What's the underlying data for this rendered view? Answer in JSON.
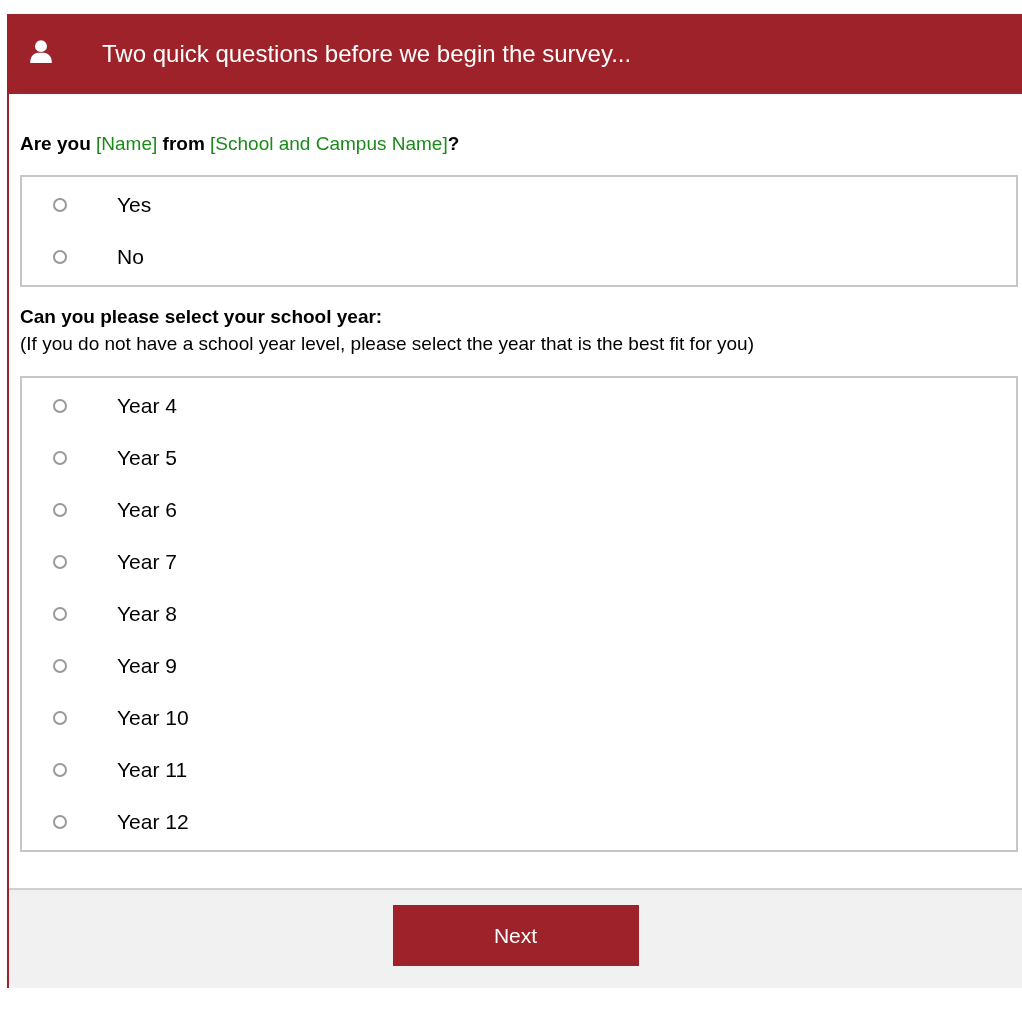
{
  "header": {
    "title": "Two quick questions before we begin the survey..."
  },
  "questions": [
    {
      "prompt": [
        {
          "text": "Are you ",
          "kind": "bold"
        },
        {
          "text": "[Name]",
          "kind": "field"
        },
        {
          "text": " from ",
          "kind": "bold"
        },
        {
          "text": "[School and Campus Name]",
          "kind": "field"
        },
        {
          "text": "?",
          "kind": "bold"
        }
      ],
      "options": [
        {
          "label": "Yes",
          "selected": false
        },
        {
          "label": "No",
          "selected": false
        }
      ]
    },
    {
      "prompt": [
        {
          "text": "Can you please select your school year:",
          "kind": "bold"
        }
      ],
      "note": "(If you do not have a school year level, please select the year that is the best fit for you)",
      "options": [
        {
          "label": "Year 4",
          "selected": false
        },
        {
          "label": "Year 5",
          "selected": false
        },
        {
          "label": "Year 6",
          "selected": false
        },
        {
          "label": "Year 7",
          "selected": false
        },
        {
          "label": "Year 8",
          "selected": false
        },
        {
          "label": "Year 9",
          "selected": false
        },
        {
          "label": "Year 10",
          "selected": false
        },
        {
          "label": "Year 11",
          "selected": false
        },
        {
          "label": "Year 12",
          "selected": false
        }
      ]
    }
  ],
  "footer": {
    "button": "Next"
  }
}
